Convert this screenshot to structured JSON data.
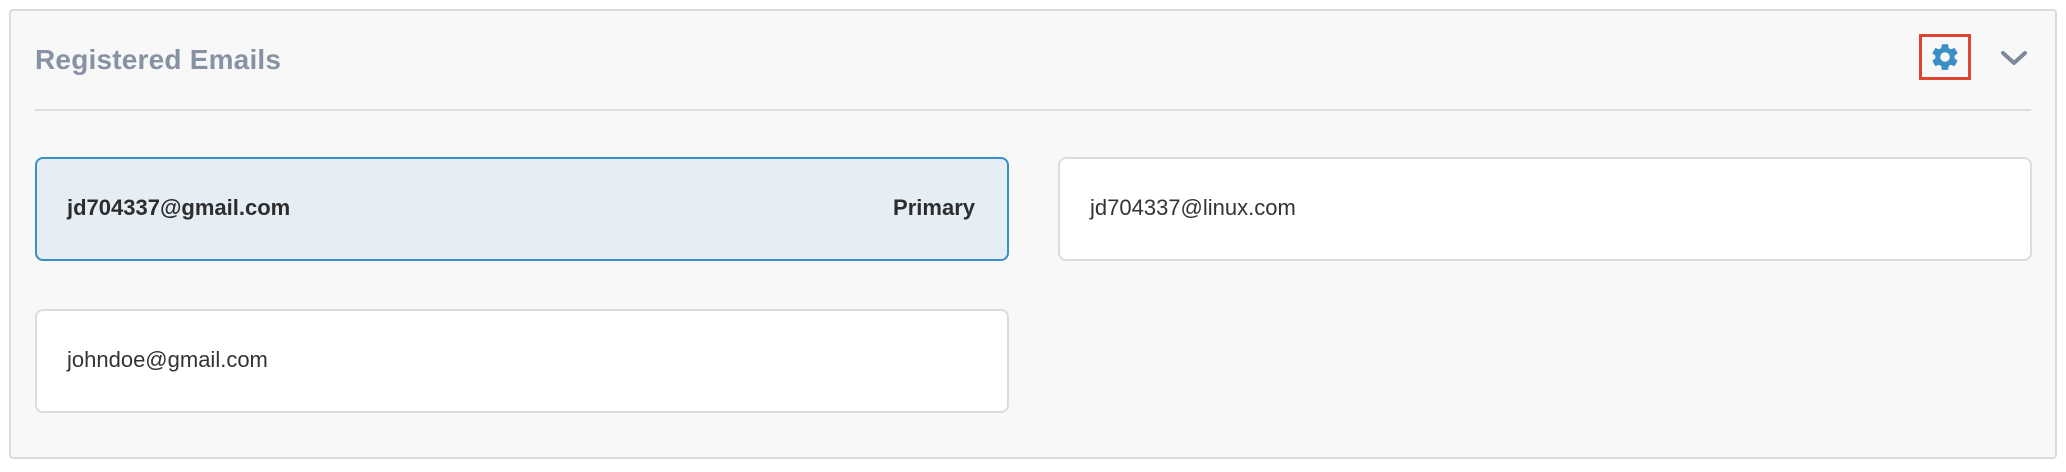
{
  "panel": {
    "title": "Registered Emails",
    "settings_icon": "gear-icon",
    "collapse_icon": "chevron-down-icon",
    "accent_color": "#3a8fc4",
    "highlight_color": "#e0432f"
  },
  "emails": [
    {
      "address": "jd704337@gmail.com",
      "badge": "Primary",
      "is_primary": true
    },
    {
      "address": "jd704337@linux.com",
      "badge": "",
      "is_primary": false
    },
    {
      "address": "johndoe@gmail.com",
      "badge": "",
      "is_primary": false
    }
  ]
}
